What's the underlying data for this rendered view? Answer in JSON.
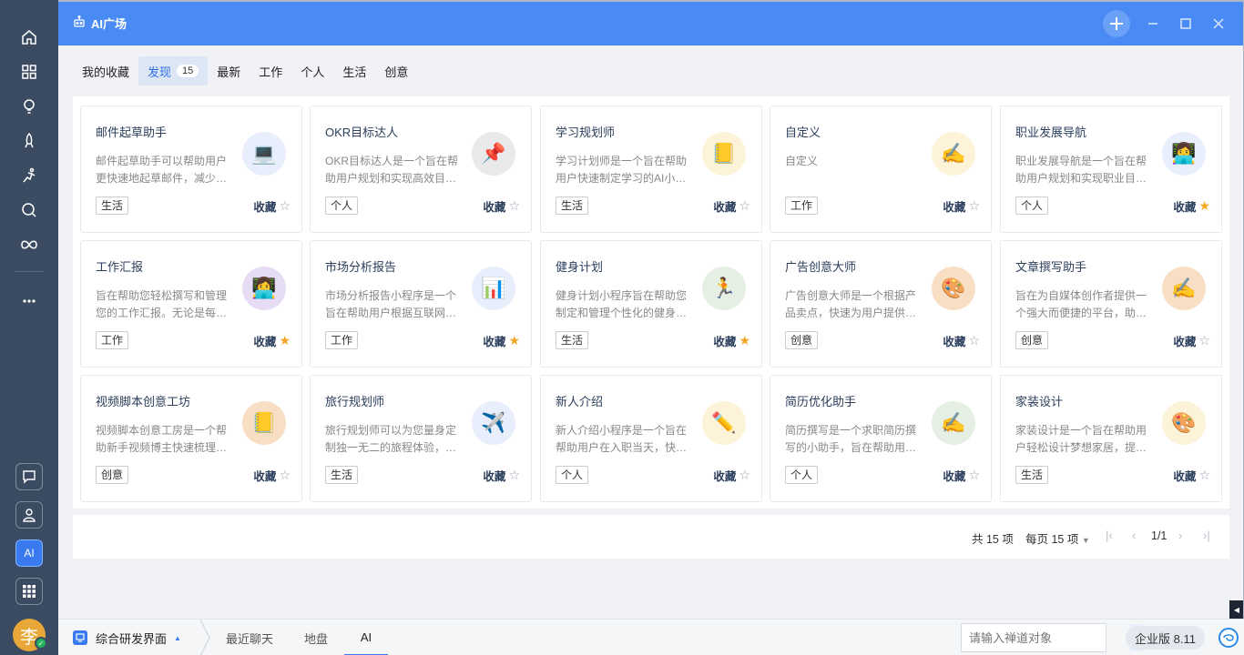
{
  "window": {
    "title": "AI广场"
  },
  "tabs": [
    {
      "label": "我的收藏",
      "count": ""
    },
    {
      "label": "发现",
      "count": "15"
    },
    {
      "label": "最新",
      "count": ""
    },
    {
      "label": "工作",
      "count": ""
    },
    {
      "label": "个人",
      "count": ""
    },
    {
      "label": "生活",
      "count": ""
    },
    {
      "label": "创意",
      "count": ""
    }
  ],
  "fav_label": "收藏",
  "cards": [
    {
      "title": "邮件起草助手",
      "desc": "邮件起草助手可以帮助用户更快速地起草邮件，减少…",
      "tag": "生活",
      "icon": "laptop-icon",
      "emoji": "💻",
      "bg": "#e8eefb",
      "fav": false
    },
    {
      "title": "OKR目标达人",
      "desc": "OKR目标达人是一个旨在帮助用户规划和实现高效目…",
      "tag": "个人",
      "icon": "pin-icon",
      "emoji": "📌",
      "bg": "#e9e9ec",
      "fav": false
    },
    {
      "title": "学习规划师",
      "desc": "学习计划师是一个旨在帮助用户快速制定学习的AI小…",
      "tag": "生活",
      "icon": "notebook-icon",
      "emoji": "📒",
      "bg": "#fdf3d8",
      "fav": false
    },
    {
      "title": "自定义",
      "desc": "自定义",
      "tag": "工作",
      "icon": "writing-hand-icon",
      "emoji": "✍️",
      "bg": "#fdf3d8",
      "fav": false
    },
    {
      "title": "职业发展导航",
      "desc": "职业发展导航是一个旨在帮助用户规划和实现职业目…",
      "tag": "个人",
      "icon": "office-worker-icon",
      "emoji": "👩‍💻",
      "bg": "#e8eefb",
      "fav": true
    },
    {
      "title": "工作汇报",
      "desc": "旨在帮助您轻松撰写和管理您的工作汇报。无论是每…",
      "tag": "工作",
      "icon": "office-worker-icon",
      "emoji": "👩‍💻",
      "bg": "#e6dcf3",
      "fav": true
    },
    {
      "title": "市场分析报告",
      "desc": "市场分析报告小程序是一个旨在帮助用户根据互联网…",
      "tag": "工作",
      "icon": "bar-chart-icon",
      "emoji": "📊",
      "bg": "#e8eefb",
      "fav": true
    },
    {
      "title": "健身计划",
      "desc": "健身计划小程序旨在帮助您制定和管理个性化的健身…",
      "tag": "生活",
      "icon": "fitness-icon",
      "emoji": "🏃",
      "bg": "#e6efe3",
      "fav": true
    },
    {
      "title": "广告创意大师",
      "desc": "广告创意大师是一个根据产品卖点，快速为用户提供…",
      "tag": "创意",
      "icon": "palette-icon",
      "emoji": "🎨",
      "bg": "#f8dfc4",
      "fav": false
    },
    {
      "title": "文章撰写助手",
      "desc": "旨在为自媒体创作者提供一个强大而便捷的平台，助…",
      "tag": "创意",
      "icon": "writing-hand-icon",
      "emoji": "✍️",
      "bg": "#f8dfc4",
      "fav": false
    },
    {
      "title": "视频脚本创意工坊",
      "desc": "视频脚本创意工房是一个帮助新手视频博主快速梳理…",
      "tag": "创意",
      "icon": "notebook-icon",
      "emoji": "📒",
      "bg": "#f8dfc4",
      "fav": false
    },
    {
      "title": "旅行规划师",
      "desc": "旅行规划师可以为您量身定制独一无二的旅程体验，…",
      "tag": "生活",
      "icon": "airplane-icon",
      "emoji": "✈️",
      "bg": "#e8eefb",
      "fav": false
    },
    {
      "title": "新人介绍",
      "desc": "新人介绍小程序是一个旨在帮助用户在入职当天，快…",
      "tag": "个人",
      "icon": "pencil-icon",
      "emoji": "✏️",
      "bg": "#fdf3d8",
      "fav": false
    },
    {
      "title": "简历优化助手",
      "desc": "简历撰写是一个求职简历撰写的小助手，旨在帮助用…",
      "tag": "个人",
      "icon": "writing-hand-icon",
      "emoji": "✍️",
      "bg": "#e6efe3",
      "fav": false
    },
    {
      "title": "家装设计",
      "desc": "家装设计是一个旨在帮助用户轻松设计梦想家居，提…",
      "tag": "生活",
      "icon": "palette-icon",
      "emoji": "🎨",
      "bg": "#fdf3d8",
      "fav": false
    }
  ],
  "pager": {
    "total": "共 15 项",
    "per_page": "每页 15 项",
    "page": "1/1"
  },
  "statusbar": {
    "workspace": "综合研发界面",
    "items": [
      "最近聊天",
      "地盘",
      "AI"
    ],
    "search_placeholder": "请输入禅道对象",
    "version": "企业版 8.11"
  },
  "sidebar": {
    "ai_label": "AI",
    "avatar_text": "李"
  }
}
